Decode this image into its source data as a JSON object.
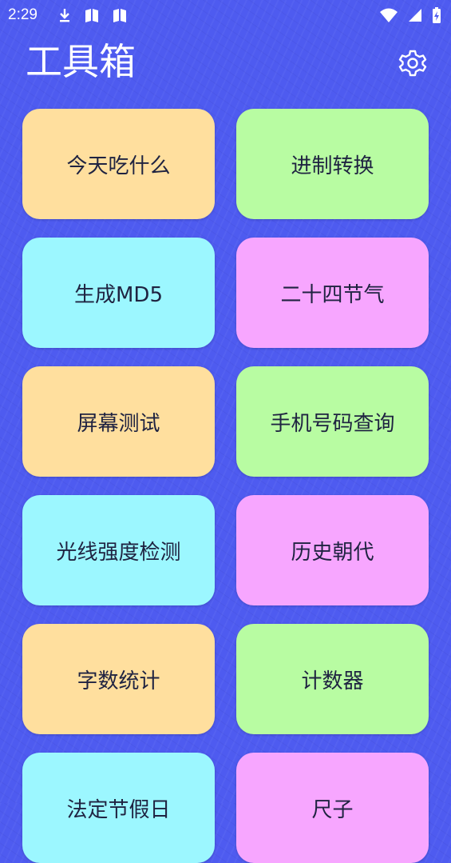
{
  "status_bar": {
    "time": "2:29",
    "icons": [
      "download-icon",
      "book-icon",
      "book-icon",
      "wifi-icon",
      "signal-icon",
      "battery-charging-icon"
    ]
  },
  "header": {
    "title": "工具箱",
    "settings_icon": "gear-icon"
  },
  "colors": {
    "background": "#4e5bf0",
    "orange": "#ffdf9e",
    "green": "#b8fca2",
    "cyan": "#9cf7ff",
    "pink": "#f7a6ff",
    "text": "#1f2341"
  },
  "tools": [
    {
      "label": "今天吃什么",
      "color": "orange"
    },
    {
      "label": "进制转换",
      "color": "green"
    },
    {
      "label": "生成MD5",
      "color": "cyan"
    },
    {
      "label": "二十四节气",
      "color": "pink"
    },
    {
      "label": "屏幕测试",
      "color": "orange"
    },
    {
      "label": "手机号码查询",
      "color": "green"
    },
    {
      "label": "光线强度检测",
      "color": "cyan"
    },
    {
      "label": "历史朝代",
      "color": "pink"
    },
    {
      "label": "字数统计",
      "color": "orange"
    },
    {
      "label": "计数器",
      "color": "green"
    },
    {
      "label": "法定节假日",
      "color": "cyan"
    },
    {
      "label": "尺子",
      "color": "pink"
    }
  ]
}
